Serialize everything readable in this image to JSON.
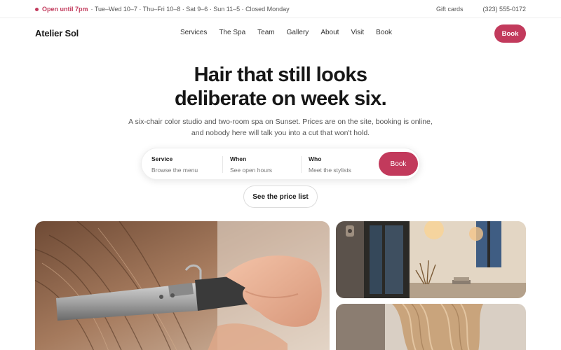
{
  "topbar": {
    "open_label": "Open until 7pm",
    "hours_text": "· Tue–Wed 10–7 · Thu–Fri 10–8 · Sat 9–6 · Sun 11–5 · Closed Monday",
    "gift_cards": "Gift cards",
    "phone": "(323) 555-0172"
  },
  "nav": {
    "brand": "Atelier Sol",
    "links": [
      "Services",
      "The Spa",
      "Team",
      "Gallery",
      "About",
      "Visit",
      "Book"
    ],
    "book_label": "Book"
  },
  "hero": {
    "headline_line1": "Hair that still looks",
    "headline_line2": "deliberate on week six.",
    "subline1": "A six-chair color studio and two-room spa on Sunset. Prices are on the site, booking is online,",
    "subline2": "and nobody here will talk you into a cut that won't hold."
  },
  "booking": {
    "service_label": "Service",
    "service_value": "Browse the menu",
    "when_label": "When",
    "when_value": "See open hours",
    "who_label": "Who",
    "who_value": "Meet the stylists",
    "book_label": "Book"
  },
  "price_list_label": "See the price list",
  "colors": {
    "accent": "#c23a5c",
    "text": "#1c1c1c",
    "muted": "#555555"
  },
  "images": {
    "main": "curling-iron-photo",
    "spa": "spa-room-photo",
    "hair": "wavy-hair-photo"
  }
}
